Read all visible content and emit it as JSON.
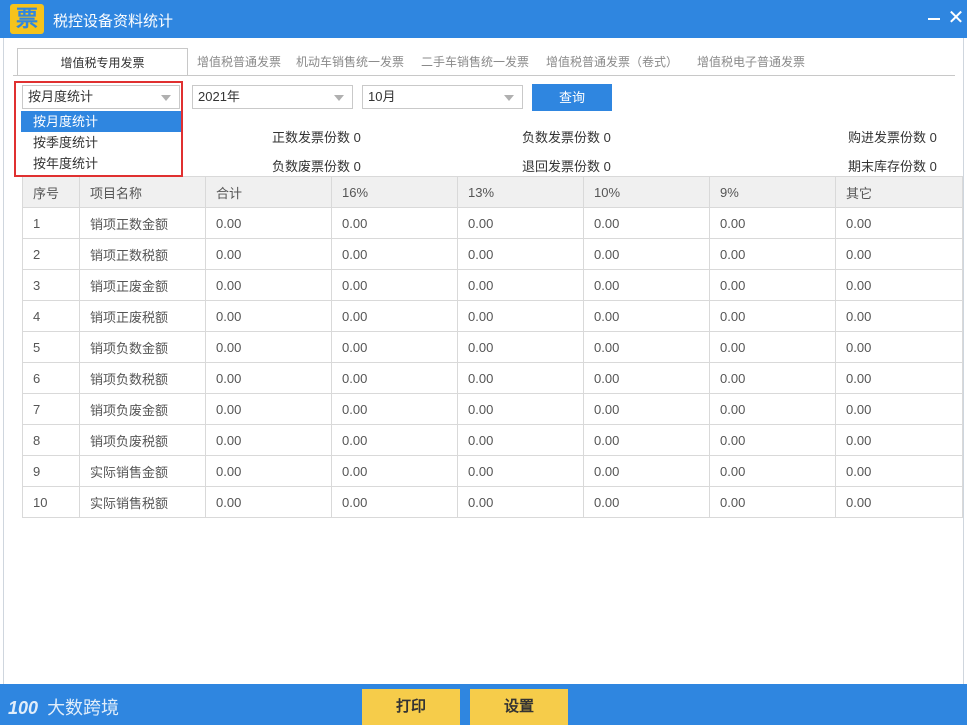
{
  "window": {
    "logo_char": "票",
    "title": "税控设备资料统计",
    "minimize_glyph": "—",
    "close_glyph": "✕",
    "icons": {
      "minimize": "minimize-icon",
      "close": "close-icon"
    }
  },
  "tabs": [
    {
      "label": "增值税专用发票",
      "active": true
    },
    {
      "label": "增值税普通发票",
      "active": false
    },
    {
      "label": "机动车销售统一发票",
      "active": false
    },
    {
      "label": "二手车销售统一发票",
      "active": false
    },
    {
      "label": "增值税普通发票（卷式）",
      "active": false
    },
    {
      "label": "增值税电子普通发票",
      "active": false
    }
  ],
  "filters": {
    "period_type": {
      "value": "按月度统计",
      "options": [
        "按月度统计",
        "按季度统计",
        "按年度统计"
      ]
    },
    "year": {
      "value": "2021年"
    },
    "month": {
      "value": "10月"
    },
    "query_label": "查询"
  },
  "stats": {
    "positive_invoices": "正数发票份数 0",
    "negative_invoices": "负数发票份数 0",
    "purchased_invoices": "购进发票份数 0",
    "negative_void_invoices": "负数废票份数 0",
    "returned_invoices": "退回发票份数 0",
    "ending_stock": "期末库存份数 0"
  },
  "table": {
    "headers": [
      "序号",
      "项目名称",
      "合计",
      "16%",
      "13%",
      "10%",
      "9%",
      "其它"
    ],
    "rows": [
      [
        "1",
        "销项正数金额",
        "0.00",
        "0.00",
        "0.00",
        "0.00",
        "0.00",
        "0.00"
      ],
      [
        "2",
        "销项正数税额",
        "0.00",
        "0.00",
        "0.00",
        "0.00",
        "0.00",
        "0.00"
      ],
      [
        "3",
        "销项正废金额",
        "0.00",
        "0.00",
        "0.00",
        "0.00",
        "0.00",
        "0.00"
      ],
      [
        "4",
        "销项正废税额",
        "0.00",
        "0.00",
        "0.00",
        "0.00",
        "0.00",
        "0.00"
      ],
      [
        "5",
        "销项负数金额",
        "0.00",
        "0.00",
        "0.00",
        "0.00",
        "0.00",
        "0.00"
      ],
      [
        "6",
        "销项负数税额",
        "0.00",
        "0.00",
        "0.00",
        "0.00",
        "0.00",
        "0.00"
      ],
      [
        "7",
        "销项负废金额",
        "0.00",
        "0.00",
        "0.00",
        "0.00",
        "0.00",
        "0.00"
      ],
      [
        "8",
        "销项负废税额",
        "0.00",
        "0.00",
        "0.00",
        "0.00",
        "0.00",
        "0.00"
      ],
      [
        "9",
        "实际销售金额",
        "0.00",
        "0.00",
        "0.00",
        "0.00",
        "0.00",
        "0.00"
      ],
      [
        "10",
        "实际销售税额",
        "0.00",
        "0.00",
        "0.00",
        "0.00",
        "0.00",
        "0.00"
      ]
    ]
  },
  "footer": {
    "print_label": "打印",
    "settings_label": "设置",
    "watermark": {
      "logo": "100",
      "text": "大数跨境"
    }
  },
  "colors": {
    "brand_blue": "#2f86e0",
    "footer_button": "#f6cc4a",
    "highlight_red": "#e03030"
  }
}
